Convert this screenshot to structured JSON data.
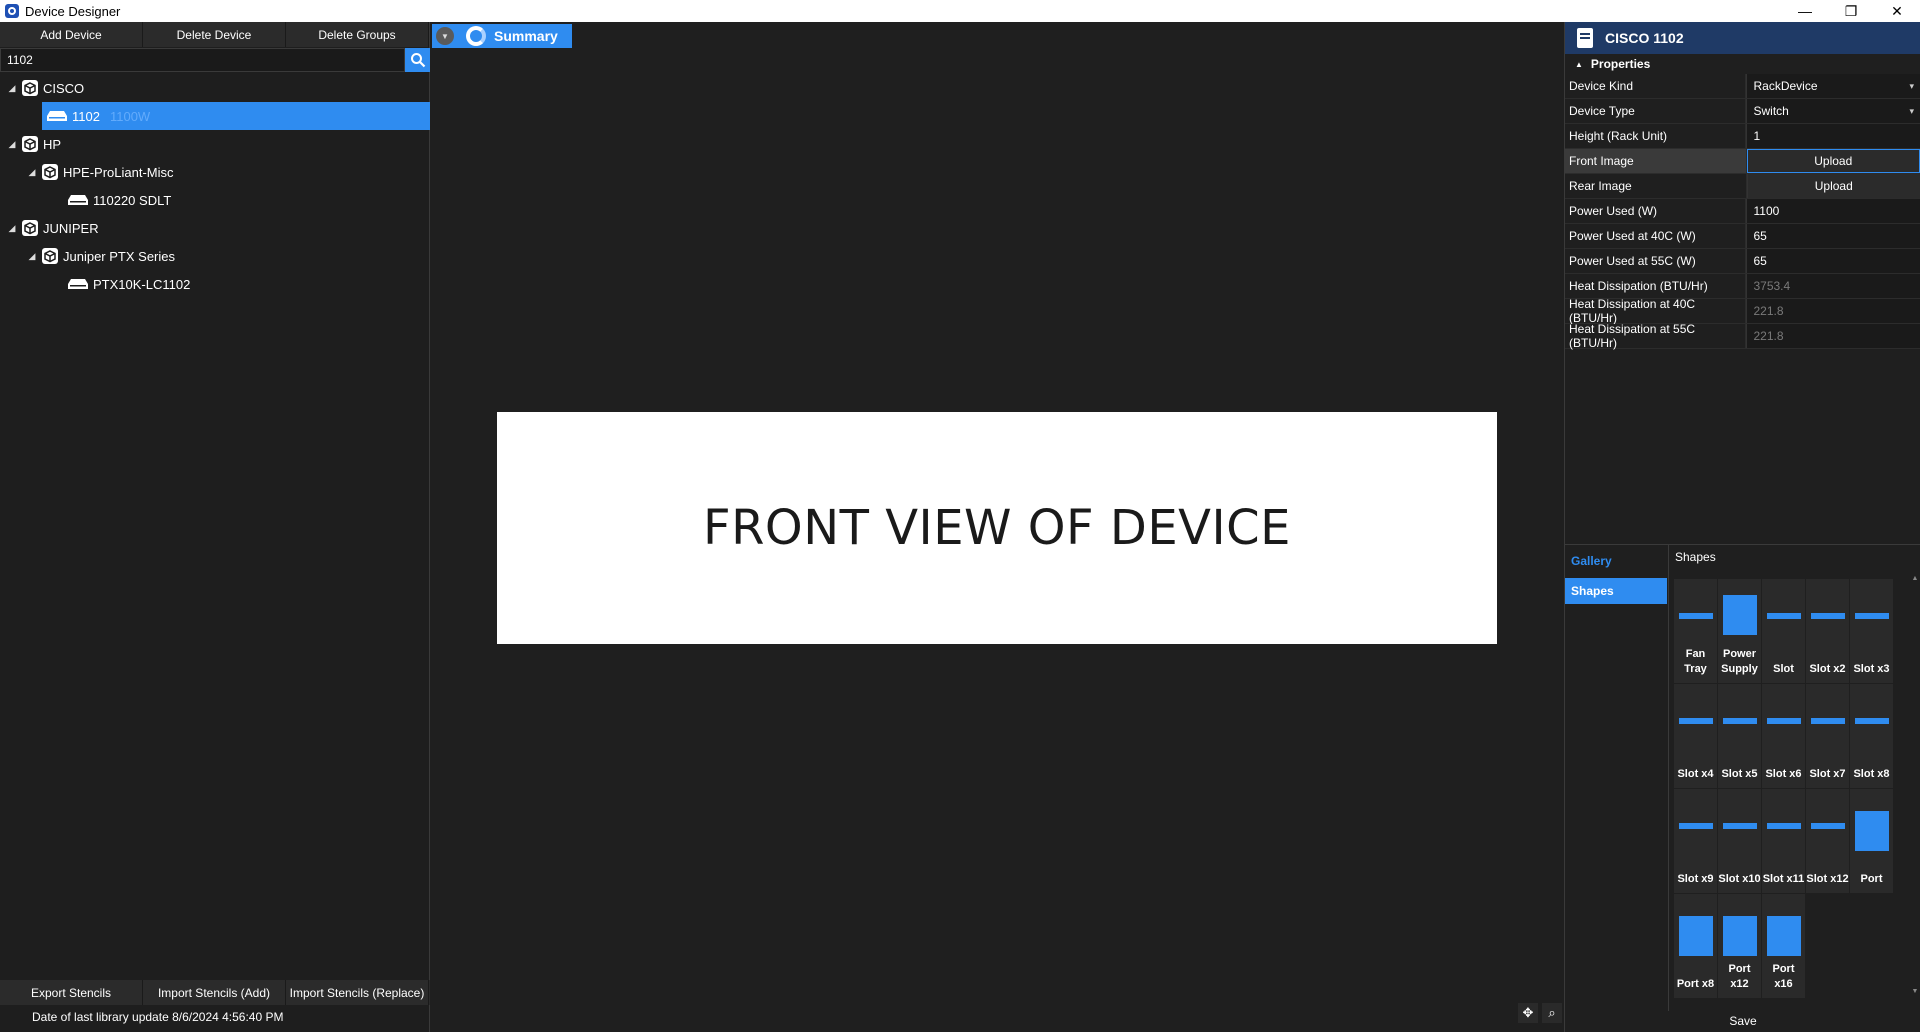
{
  "window": {
    "title": "Device Designer",
    "min": "—",
    "max": "❐",
    "close": "✕"
  },
  "toolbar": {
    "add": "Add Device",
    "delete": "Delete Device",
    "delete_groups": "Delete Groups"
  },
  "search": {
    "value": "1102"
  },
  "tree": {
    "cisco": {
      "label": "CISCO",
      "child": {
        "label": "1102",
        "sub": "1100W"
      }
    },
    "hp": {
      "label": "HP",
      "group": "HPE-ProLiant-Misc",
      "child": "110220 SDLT"
    },
    "juniper": {
      "label": "JUNIPER",
      "group": "Juniper PTX Series",
      "child": "PTX10K-LC1102"
    }
  },
  "bottom": {
    "export": "Export Stencils",
    "import_add": "Import Stencils (Add)",
    "import_replace": "Import Stencils (Replace)",
    "date": "Date of last library update 8/6/2024 4:56:40 PM"
  },
  "center": {
    "tab": "Summary",
    "front_text": "FRONT VIEW OF DEVICE"
  },
  "right": {
    "title": "CISCO 1102",
    "section": "Properties",
    "props": [
      {
        "name": "Device Kind",
        "value": "RackDevice"
      },
      {
        "name": "Device Type",
        "value": "Switch"
      },
      {
        "name": "Height (Rack Unit)",
        "value": "1"
      },
      {
        "name": "Front Image",
        "value": "Upload"
      },
      {
        "name": "Rear Image",
        "value": "Upload"
      },
      {
        "name": "Power Used (W)",
        "value": "1100"
      },
      {
        "name": "Power Used at 40C (W)",
        "value": "65"
      },
      {
        "name": "Power Used at 55C (W)",
        "value": "65"
      },
      {
        "name": "Heat Dissipation (BTU/Hr)",
        "value": "3753.4"
      },
      {
        "name": "Heat Dissipation at 40C (BTU/Hr)",
        "value": "221.8"
      },
      {
        "name": "Heat Dissipation at 55C (BTU/Hr)",
        "value": "221.8"
      }
    ],
    "gallery": {
      "head": "Gallery",
      "shapes_nav": "Shapes",
      "shapes_title": "Shapes"
    },
    "shapes": [
      "Fan Tray",
      "Power Supply",
      "Slot",
      "Slot x2",
      "Slot x3",
      "Slot x4",
      "Slot x5",
      "Slot x6",
      "Slot x7",
      "Slot x8",
      "Slot x9",
      "Slot x10",
      "Slot x11",
      "Slot x12",
      "Port",
      "Port x8",
      "Port x12",
      "Port x16"
    ],
    "save": "Save"
  },
  "colors": {
    "accent": "#2f8cf0",
    "header": "#1f3a66",
    "bg": "#1f1f1f"
  }
}
